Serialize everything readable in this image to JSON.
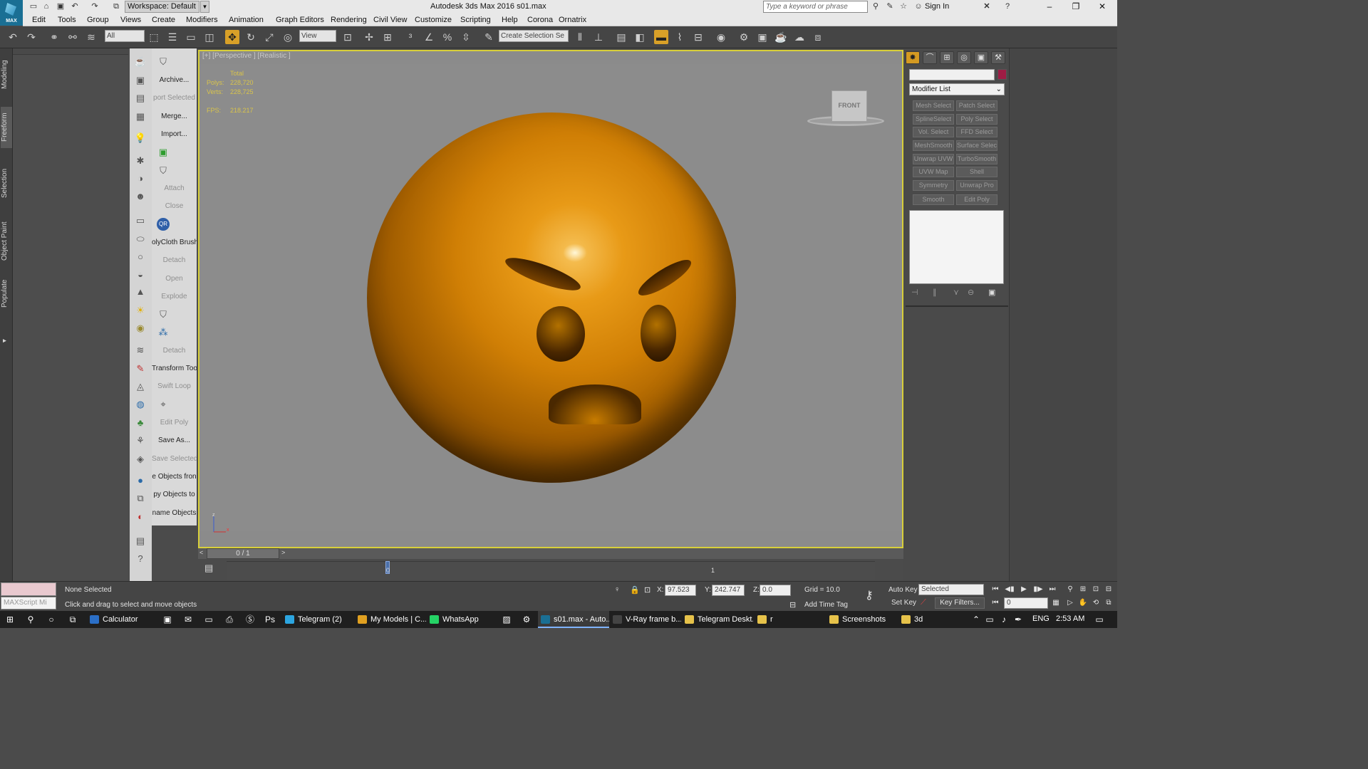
{
  "window": {
    "title": "Autodesk 3ds Max 2016     s01.max",
    "logo": "MAX",
    "workspace": "Workspace: Default",
    "search_placeholder": "Type a keyword or phrase",
    "sign_in": "Sign In"
  },
  "menu": [
    "Edit",
    "Tools",
    "Group",
    "Views",
    "Create",
    "Modifiers",
    "Animation",
    "Graph Editors",
    "Rendering",
    "Civil View",
    "Customize",
    "Scripting",
    "Help",
    "Corona",
    "Ornatrix"
  ],
  "toolbar": {
    "filter": "All",
    "ref_coord": "View",
    "selection_set": "Create Selection Se"
  },
  "ribbon_tabs": [
    "Modeling",
    "Freeform",
    "Selection",
    "Object Paint",
    "Populate"
  ],
  "script_panel": [
    {
      "label": "Archive...",
      "dim": false
    },
    {
      "label": "port Selected",
      "dim": true
    },
    {
      "label": "Merge...",
      "dim": false
    },
    {
      "label": "Import...",
      "dim": false
    },
    {
      "label": "",
      "dim": false
    },
    {
      "label": "",
      "dim": false
    },
    {
      "label": "Attach",
      "dim": true
    },
    {
      "label": "Close",
      "dim": true
    },
    {
      "label": "QR",
      "dim": false
    },
    {
      "label": "olyCloth Brush",
      "dim": false
    },
    {
      "label": "Detach",
      "dim": true
    },
    {
      "label": "Open",
      "dim": true
    },
    {
      "label": "Explode",
      "dim": true
    },
    {
      "label": "",
      "dim": false
    },
    {
      "label": "",
      "dim": false
    },
    {
      "label": "Detach",
      "dim": true
    },
    {
      "label": "Transform Tool",
      "dim": false
    },
    {
      "label": "Swift Loop",
      "dim": true
    },
    {
      "label": "",
      "dim": false
    },
    {
      "label": "Edit Poly",
      "dim": true
    },
    {
      "label": "Save As...",
      "dim": false
    },
    {
      "label": "Save Selected",
      "dim": true
    },
    {
      "label": "e Objects fron",
      "dim": false
    },
    {
      "label": "py Objects to",
      "dim": false
    },
    {
      "label": "name Objects",
      "dim": false
    }
  ],
  "viewport": {
    "label": "[+] [Perspective ] [Realistic ]",
    "stats_total": "Total",
    "polys_label": "Polys:",
    "polys_value": "228,720",
    "verts_label": "Verts:",
    "verts_value": "228,725",
    "fps_label": "FPS:",
    "fps_value": "218.217",
    "viewcube_label": "FRONT",
    "axis_z": "z",
    "axis_x": "x"
  },
  "timeline": {
    "frame": "0 / 1",
    "tick0": "0",
    "tick1": "1"
  },
  "command_panel": {
    "modifier_list": "Modifier List",
    "modifiers": [
      "Mesh Select",
      "Patch Select",
      "SplineSelect",
      "Poly Select",
      "Vol. Select",
      "FFD Select",
      "MeshSmooth",
      "Surface Select",
      "Unwrap UVW",
      "TurboSmooth",
      "UVW Map",
      "Shell",
      "Symmetry",
      "Unwrap Pro",
      "Smooth",
      "Edit Poly"
    ],
    "name_color": "#9e1c44"
  },
  "status": {
    "maxscript": "MAXScript Mi",
    "selection": "None Selected",
    "prompt": "Click and drag to select and move objects",
    "x_label": "X:",
    "x_value": "97.523",
    "y_label": "Y:",
    "y_value": "242.747",
    "z_label": "Z:",
    "z_value": "0.0",
    "grid": "Grid = 10.0",
    "add_time_tag": "Add Time Tag",
    "auto_key": "Auto Key",
    "set_key": "Set Key",
    "key_mode": "Selected",
    "key_filters": "Key Filters...",
    "current_frame": "0"
  },
  "taskbar": {
    "items": [
      {
        "label": "Calculator",
        "color": "#2b6fc7",
        "active": false
      },
      {
        "label": "Telegram (2)",
        "color": "#2ca5e0",
        "active": false
      },
      {
        "label": "My Models | C...",
        "color": "#e0a020",
        "active": false
      },
      {
        "label": "WhatsApp",
        "color": "#25d366",
        "active": false
      },
      {
        "label": "s01.max - Auto...",
        "color": "#1a6f94",
        "active": true
      },
      {
        "label": "V-Ray frame b...",
        "color": "#444444",
        "active": false
      },
      {
        "label": "Telegram Deskt...",
        "color": "#e6c24a",
        "active": false
      },
      {
        "label": "r",
        "color": "#e6c24a",
        "active": false
      },
      {
        "label": "Screenshots",
        "color": "#e6c24a",
        "active": false
      },
      {
        "label": "3d",
        "color": "#e6c24a",
        "active": false
      }
    ],
    "lang": "ENG",
    "time": "2:53 AM"
  }
}
